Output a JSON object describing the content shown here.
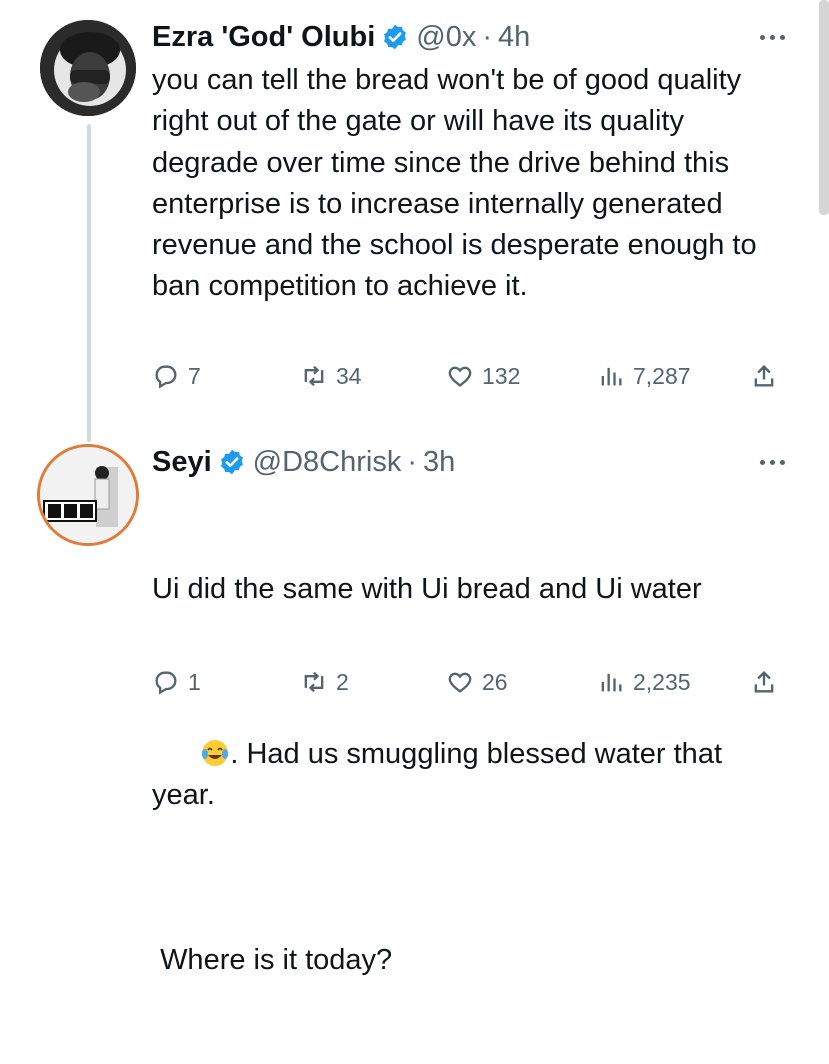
{
  "tweets": [
    {
      "name": "Ezra 'God' Olubi",
      "handle": "@0x",
      "time": "4h",
      "text": "you can tell the bread won't be of good quality right out of the gate or will have its quality degrade over time since the drive behind this enterprise is to increase internally generated revenue and the school is desperate enough to ban competition to achieve it.",
      "replies": "7",
      "reposts": "34",
      "likes": "132",
      "views": "7,287"
    },
    {
      "name": "Seyi",
      "handle": "@D8Chrisk",
      "time": "3h",
      "text_line1": "Ui did the same with Ui bread and Ui water",
      "text_line2": ". Had us smuggling blessed water that year.",
      "text_line3": " Where is it today?",
      "replies": "1",
      "reposts": "2",
      "likes": "26",
      "views": "2,235",
      "avatar_text": "BBC"
    }
  ],
  "separator": "·",
  "colors": {
    "verified": "#1d9bf0",
    "secondary_text": "#536471",
    "thread_line": "#cfd9de",
    "avatar_ring": "#e07b39"
  }
}
